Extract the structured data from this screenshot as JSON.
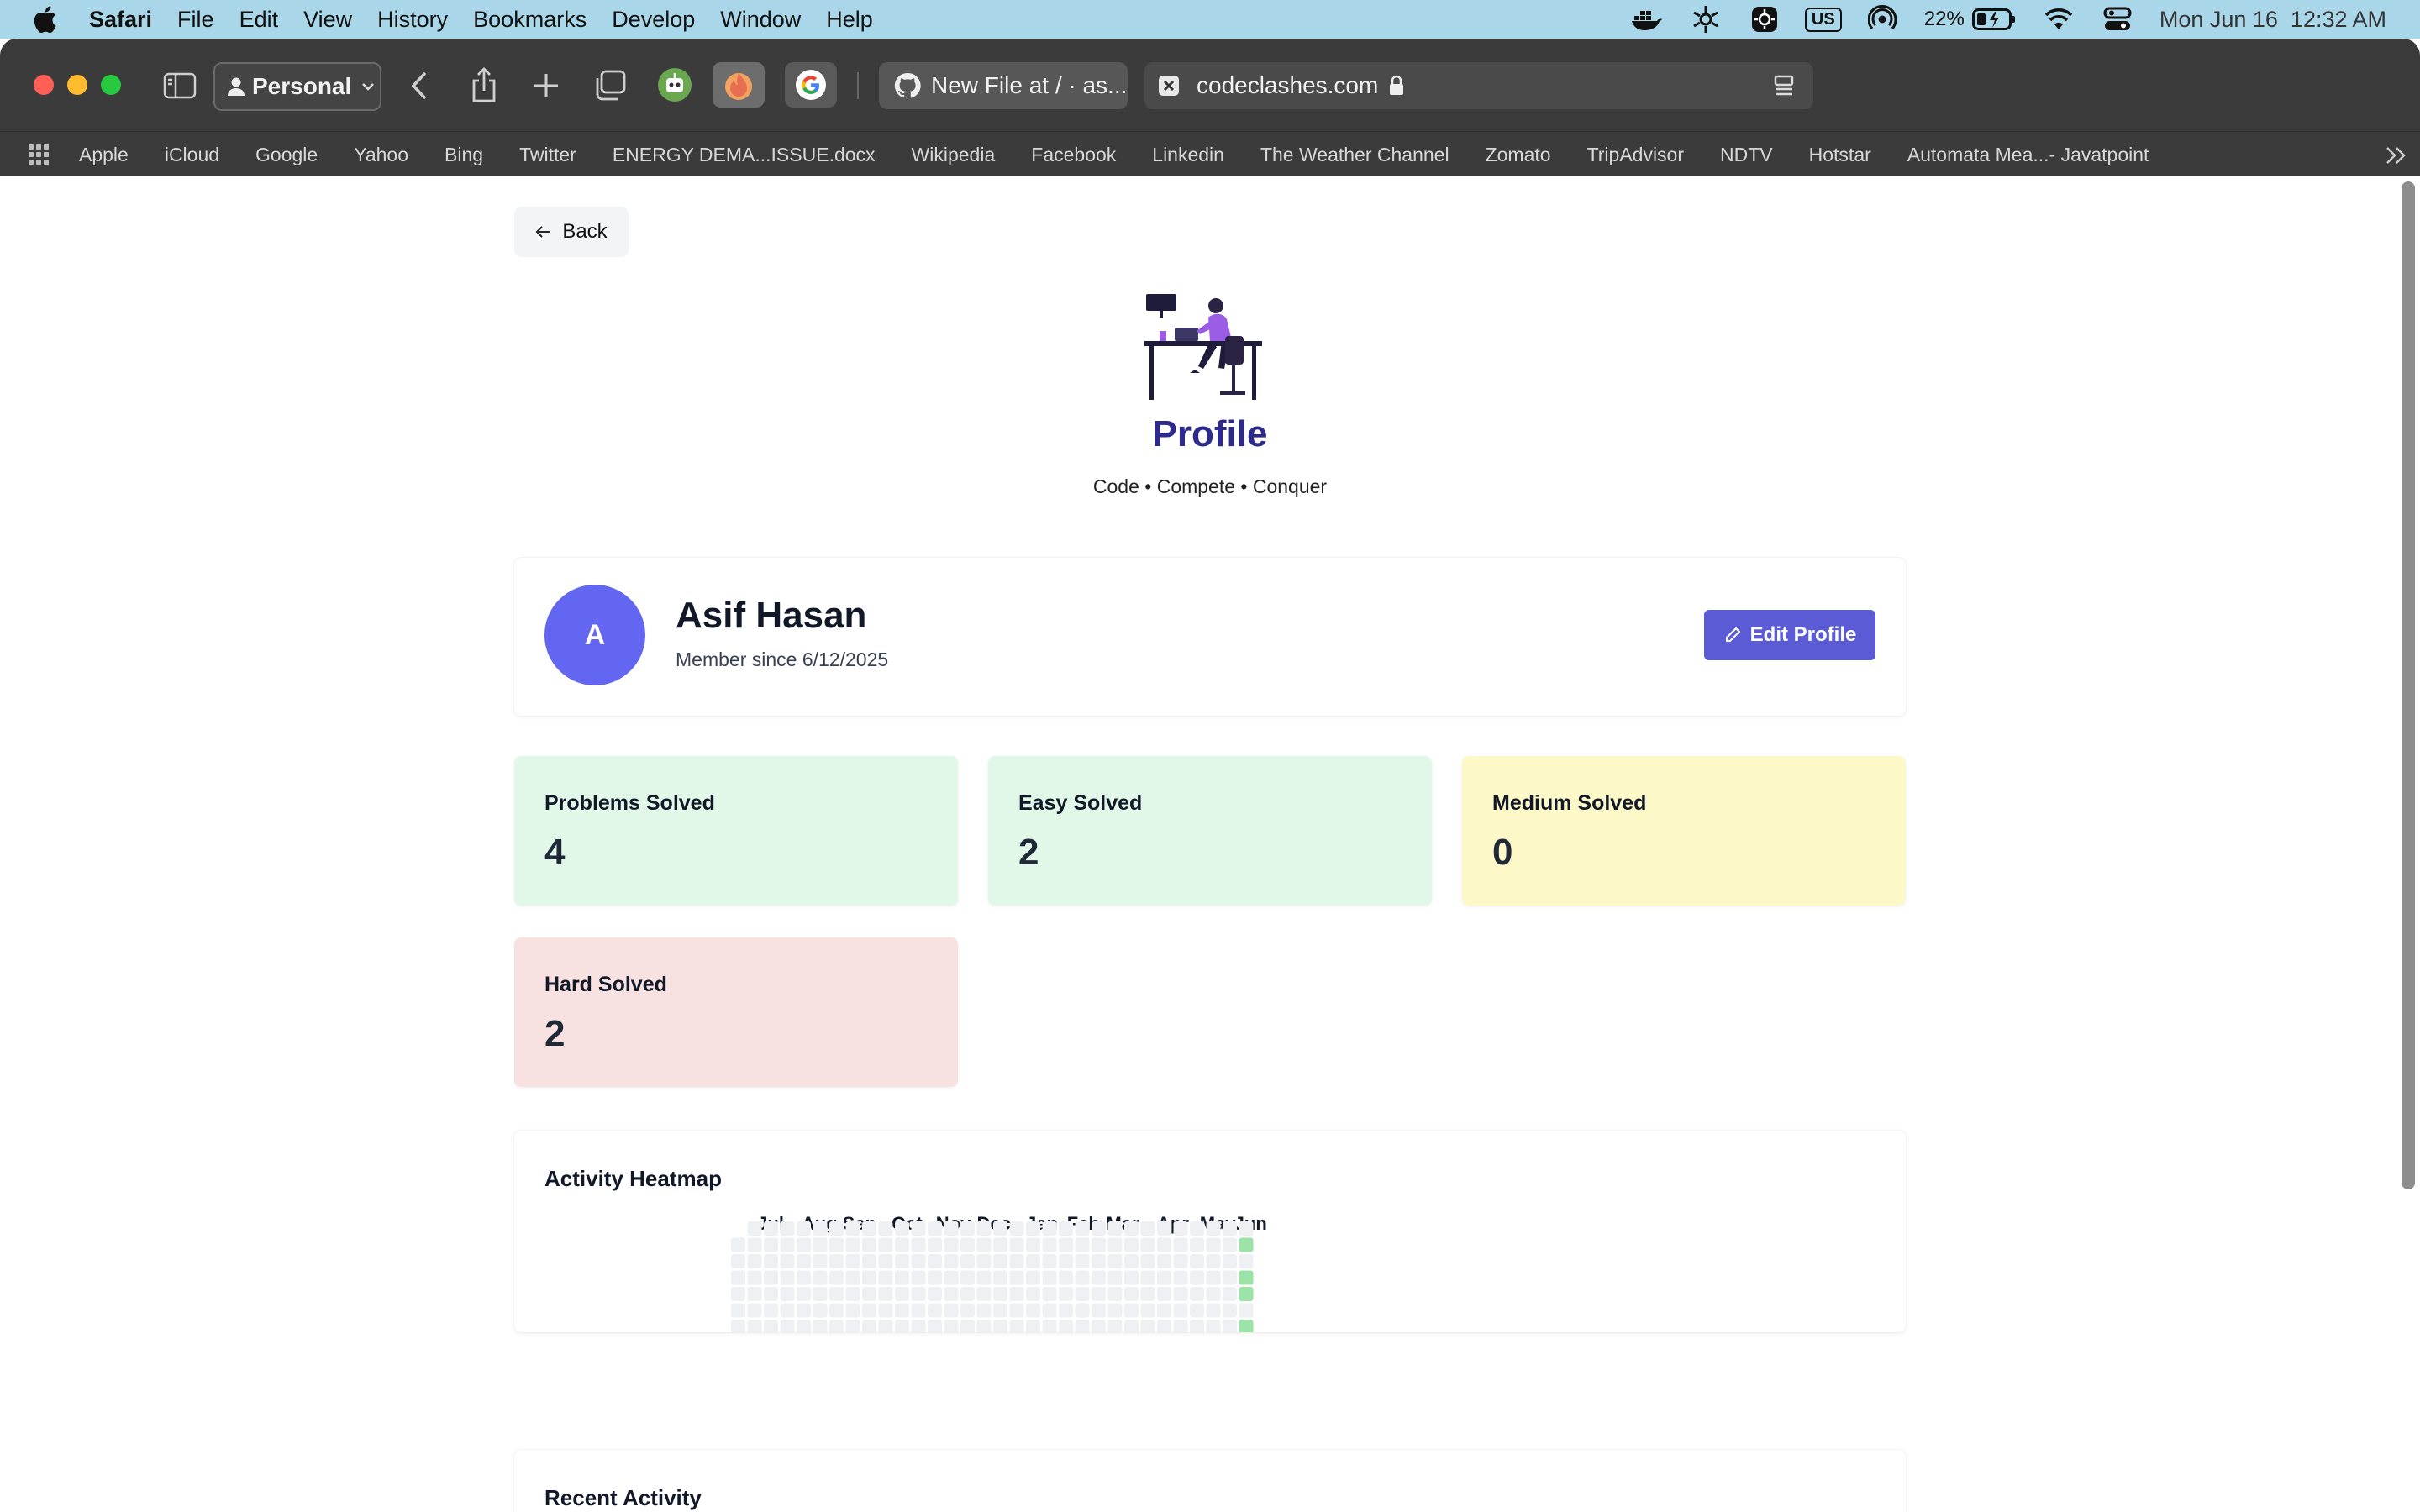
{
  "menubar": {
    "app": "Safari",
    "items": [
      "File",
      "Edit",
      "View",
      "History",
      "Bookmarks",
      "Develop",
      "Window",
      "Help"
    ],
    "battery": "22%",
    "keyboard": "US",
    "datetime": "Mon Jun 16  12:32 AM"
  },
  "toolbar": {
    "profile": "Personal",
    "tab_github": "New File at / · as...",
    "tab_active": "codeclashes.com"
  },
  "bookmarks": [
    "Apple",
    "iCloud",
    "Google",
    "Yahoo",
    "Bing",
    "Twitter",
    "ENERGY DEMA...ISSUE.docx",
    "Wikipedia",
    "Facebook",
    "Linkedin",
    "The Weather Channel",
    "Zomato",
    "TripAdvisor",
    "NDTV",
    "Hotstar",
    "Automata Mea...- Javatpoint"
  ],
  "page": {
    "back": "Back",
    "title": "Profile",
    "tagline": "Code • Compete • Conquer"
  },
  "user": {
    "initial": "A",
    "name": "Asif Hasan",
    "member_since": "Member since 6/12/2025",
    "edit": "Edit Profile"
  },
  "stats": {
    "problems": {
      "label": "Problems Solved",
      "value": "4"
    },
    "easy": {
      "label": "Easy Solved",
      "value": "2"
    },
    "medium": {
      "label": "Medium Solved",
      "value": "0"
    },
    "hard": {
      "label": "Hard Solved",
      "value": "2"
    }
  },
  "heatmap": {
    "title": "Activity Heatmap",
    "months": [
      "Jul",
      "Aug",
      "Sep",
      "Oct",
      "Nov",
      "Dec",
      "Jan",
      "Feb",
      "Mar",
      "Apr",
      "May",
      "Jun"
    ],
    "colors": {
      "empty": "#eef0f3",
      "active": "#9be3a6"
    },
    "active_days": [
      1,
      3,
      4,
      6
    ]
  },
  "recent": {
    "title": "Recent Activity"
  }
}
